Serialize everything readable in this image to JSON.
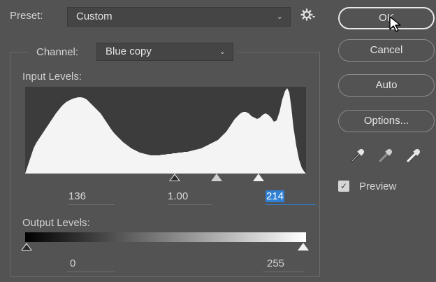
{
  "preset": {
    "label": "Preset:",
    "value": "Custom"
  },
  "channel": {
    "label": "Channel:",
    "value": "Blue copy"
  },
  "input_levels": {
    "label": "Input Levels:",
    "black": "136",
    "gamma": "1.00",
    "white": "214"
  },
  "output_levels": {
    "label": "Output Levels:",
    "black": "0",
    "white": "255"
  },
  "buttons": {
    "ok": "OK",
    "cancel": "Cancel",
    "auto": "Auto",
    "options": "Options..."
  },
  "preview": {
    "label": "Preview",
    "checked": true
  },
  "icons": {
    "gear": "gear-icon",
    "dropdown": "chevron-down-icon",
    "eyedroppers": [
      "black-eyedropper-icon",
      "gray-eyedropper-icon",
      "white-eyedropper-icon"
    ]
  },
  "colors": {
    "selection": "#2f7fd4",
    "background": "#535353"
  }
}
